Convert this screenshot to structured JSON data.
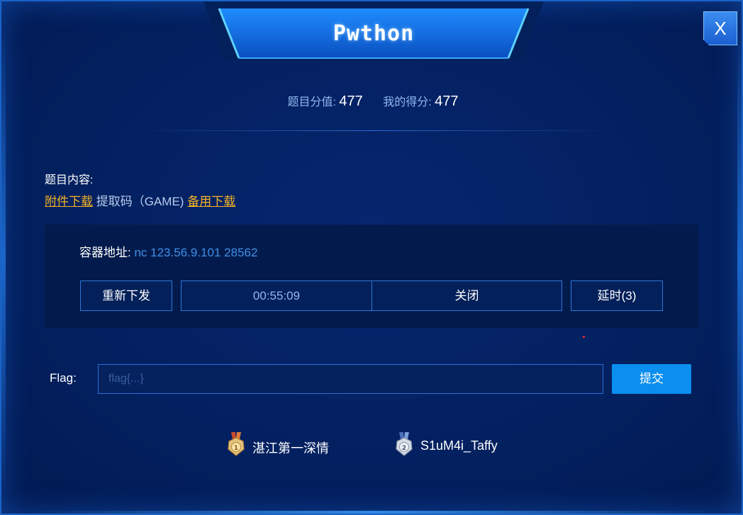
{
  "title": "Pwthon",
  "close_label": "X",
  "score": {
    "value_label": "题目分值:",
    "value": "477",
    "my_label": "我的得分:",
    "my": "477"
  },
  "content": {
    "label": "题目内容:",
    "attachment_link": "附件下载",
    "code_text": "提取码（GAME)",
    "backup_link": "备用下载"
  },
  "container": {
    "label": "容器地址:",
    "address": "nc 123.56.9.101 28562",
    "resend_label": "重新下发",
    "timer": "00:55:09",
    "close_label": "关闭",
    "extend_label": "延时(3)"
  },
  "flag": {
    "label": "Flag:",
    "placeholder": "flag{...}",
    "submit_label": "提交"
  },
  "solvers": [
    {
      "rank": "1",
      "name": "湛江第一深情",
      "medal": "gold-medal-icon"
    },
    {
      "rank": "2",
      "name": "S1uM4i_Taffy",
      "medal": "silver-medal-icon"
    }
  ],
  "colors": {
    "background": "#03205f",
    "accent": "#0a8ef0",
    "link": "#f5b326",
    "address": "#3f8fe8"
  }
}
